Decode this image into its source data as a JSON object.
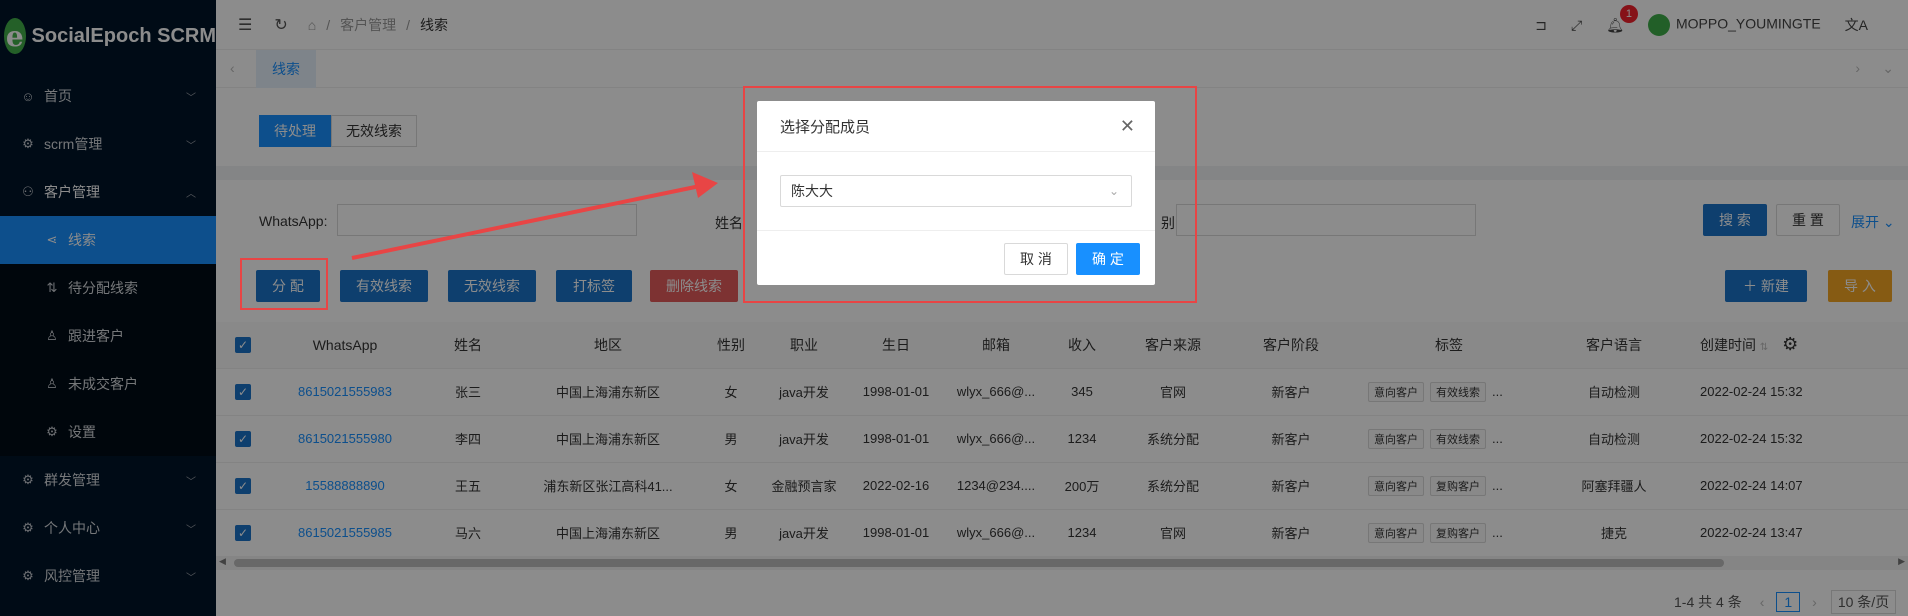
{
  "app": {
    "logo_letter": "e",
    "brand": "SocialEpoch SCRM"
  },
  "sidebar": {
    "items": [
      {
        "icon": "☺",
        "label": "首页",
        "icon_name": "dashboard-icon"
      },
      {
        "icon": "⚙",
        "label": "scrm管理",
        "icon_name": "gear-icon"
      },
      {
        "icon": "⚇",
        "label": "客户管理",
        "icon_name": "users-icon"
      }
    ],
    "sub_items": [
      {
        "icon": "⋖",
        "label": "线索",
        "icon_name": "share-icon",
        "active": true
      },
      {
        "icon": "⇅",
        "label": "待分配线索",
        "icon_name": "sort-icon"
      },
      {
        "icon": "♙",
        "label": "跟进客户",
        "icon_name": "user-icon"
      },
      {
        "icon": "♙",
        "label": "未成交客户",
        "icon_name": "user-icon"
      },
      {
        "icon": "⚙",
        "label": "设置",
        "icon_name": "gear-icon"
      }
    ],
    "bottom_items": [
      {
        "icon": "⚙",
        "label": "群发管理",
        "icon_name": "gear-icon"
      },
      {
        "icon": "⚙",
        "label": "个人中心",
        "icon_name": "gear-icon"
      },
      {
        "icon": "⚙",
        "label": "风控管理",
        "icon_name": "gear-icon"
      }
    ]
  },
  "topbar": {
    "breadcrumb": [
      "客户管理",
      "线索"
    ],
    "notification_count": "1",
    "username": "MOPPO_YOUMINGTE"
  },
  "tabs": {
    "active": "线索"
  },
  "toolbar": {
    "toggle": [
      "待处理",
      "无效线索"
    ],
    "filters": {
      "whatsapp_label": "WhatsApp:",
      "name_label": "姓名",
      "third_label": "别:"
    },
    "search": "搜 索",
    "reset": "重 置",
    "expand": "展开",
    "actions": {
      "assign": "分 配",
      "valid": "有效线索",
      "invalid": "无效线索",
      "tag": "打标签",
      "delete": "删除线索",
      "new": "＋ 新建",
      "import": "导 入"
    }
  },
  "table": {
    "columns": [
      "WhatsApp",
      "姓名",
      "地区",
      "性别",
      "职业",
      "生日",
      "邮箱",
      "收入",
      "客户来源",
      "客户阶段",
      "标签",
      "客户语言",
      "创建时间"
    ],
    "rows": [
      {
        "whatsapp": "8615021555983",
        "name": "张三",
        "region": "中国上海浦东新区",
        "gender": "女",
        "job": "java开发",
        "birthday": "1998-01-01",
        "email": "wlyx_666@...",
        "income": "345",
        "source": "官网",
        "stage": "新客户",
        "tag1": "意向客户",
        "tag2": "有效线索",
        "more": "...",
        "lang": "自动检测",
        "created": "2022-02-24 15:32"
      },
      {
        "whatsapp": "8615021555980",
        "name": "李四",
        "region": "中国上海浦东新区",
        "gender": "男",
        "job": "java开发",
        "birthday": "1998-01-01",
        "email": "wlyx_666@...",
        "income": "1234",
        "source": "系统分配",
        "stage": "新客户",
        "tag1": "意向客户",
        "tag2": "有效线索",
        "more": "...",
        "lang": "自动检测",
        "created": "2022-02-24 15:32"
      },
      {
        "whatsapp": "15588888890",
        "name": "王五",
        "region": "浦东新区张江高科41...",
        "gender": "女",
        "job": "金融预言家",
        "birthday": "2022-02-16",
        "email": "1234@234....",
        "income": "200万",
        "source": "系统分配",
        "stage": "新客户",
        "tag1": "意向客户",
        "tag2": "复购客户",
        "more": "...",
        "lang": "阿塞拜疆人",
        "created": "2022-02-24 14:07"
      },
      {
        "whatsapp": "8615021555985",
        "name": "马六",
        "region": "中国上海浦东新区",
        "gender": "男",
        "job": "java开发",
        "birthday": "1998-01-01",
        "email": "wlyx_666@...",
        "income": "1234",
        "source": "官网",
        "stage": "新客户",
        "tag1": "意向客户",
        "tag2": "复购客户",
        "more": "...",
        "lang": "捷克",
        "created": "2022-02-24 13:47"
      }
    ]
  },
  "pagination": {
    "summary": "1-4 共 4 条",
    "current": "1",
    "page_size": "10 条/页"
  },
  "modal": {
    "title": "选择分配成员",
    "selected": "陈大大",
    "cancel": "取 消",
    "confirm": "确 定"
  },
  "colors": {
    "primary": "#1890ff",
    "sidebar": "#001529",
    "annotation": "#e84545"
  }
}
